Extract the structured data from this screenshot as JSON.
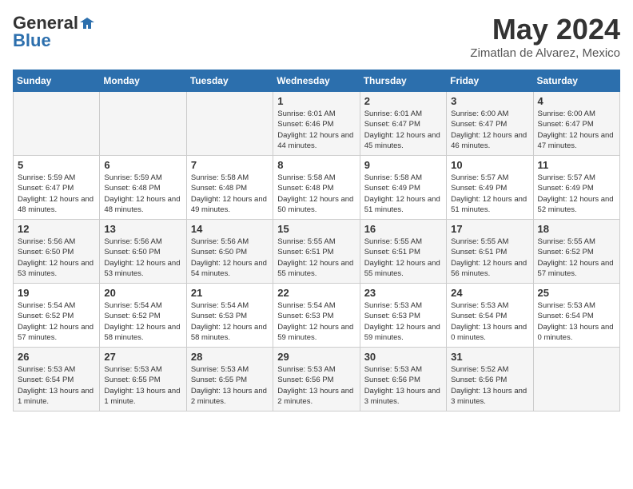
{
  "header": {
    "logo_general": "General",
    "logo_blue": "Blue",
    "month_title": "May 2024",
    "location": "Zimatlan de Alvarez, Mexico"
  },
  "days_of_week": [
    "Sunday",
    "Monday",
    "Tuesday",
    "Wednesday",
    "Thursday",
    "Friday",
    "Saturday"
  ],
  "weeks": [
    {
      "days": [
        {
          "num": "",
          "sunrise": "",
          "sunset": "",
          "daylight": ""
        },
        {
          "num": "",
          "sunrise": "",
          "sunset": "",
          "daylight": ""
        },
        {
          "num": "",
          "sunrise": "",
          "sunset": "",
          "daylight": ""
        },
        {
          "num": "1",
          "sunrise": "Sunrise: 6:01 AM",
          "sunset": "Sunset: 6:46 PM",
          "daylight": "Daylight: 12 hours and 44 minutes."
        },
        {
          "num": "2",
          "sunrise": "Sunrise: 6:01 AM",
          "sunset": "Sunset: 6:47 PM",
          "daylight": "Daylight: 12 hours and 45 minutes."
        },
        {
          "num": "3",
          "sunrise": "Sunrise: 6:00 AM",
          "sunset": "Sunset: 6:47 PM",
          "daylight": "Daylight: 12 hours and 46 minutes."
        },
        {
          "num": "4",
          "sunrise": "Sunrise: 6:00 AM",
          "sunset": "Sunset: 6:47 PM",
          "daylight": "Daylight: 12 hours and 47 minutes."
        }
      ]
    },
    {
      "days": [
        {
          "num": "5",
          "sunrise": "Sunrise: 5:59 AM",
          "sunset": "Sunset: 6:47 PM",
          "daylight": "Daylight: 12 hours and 48 minutes."
        },
        {
          "num": "6",
          "sunrise": "Sunrise: 5:59 AM",
          "sunset": "Sunset: 6:48 PM",
          "daylight": "Daylight: 12 hours and 48 minutes."
        },
        {
          "num": "7",
          "sunrise": "Sunrise: 5:58 AM",
          "sunset": "Sunset: 6:48 PM",
          "daylight": "Daylight: 12 hours and 49 minutes."
        },
        {
          "num": "8",
          "sunrise": "Sunrise: 5:58 AM",
          "sunset": "Sunset: 6:48 PM",
          "daylight": "Daylight: 12 hours and 50 minutes."
        },
        {
          "num": "9",
          "sunrise": "Sunrise: 5:58 AM",
          "sunset": "Sunset: 6:49 PM",
          "daylight": "Daylight: 12 hours and 51 minutes."
        },
        {
          "num": "10",
          "sunrise": "Sunrise: 5:57 AM",
          "sunset": "Sunset: 6:49 PM",
          "daylight": "Daylight: 12 hours and 51 minutes."
        },
        {
          "num": "11",
          "sunrise": "Sunrise: 5:57 AM",
          "sunset": "Sunset: 6:49 PM",
          "daylight": "Daylight: 12 hours and 52 minutes."
        }
      ]
    },
    {
      "days": [
        {
          "num": "12",
          "sunrise": "Sunrise: 5:56 AM",
          "sunset": "Sunset: 6:50 PM",
          "daylight": "Daylight: 12 hours and 53 minutes."
        },
        {
          "num": "13",
          "sunrise": "Sunrise: 5:56 AM",
          "sunset": "Sunset: 6:50 PM",
          "daylight": "Daylight: 12 hours and 53 minutes."
        },
        {
          "num": "14",
          "sunrise": "Sunrise: 5:56 AM",
          "sunset": "Sunset: 6:50 PM",
          "daylight": "Daylight: 12 hours and 54 minutes."
        },
        {
          "num": "15",
          "sunrise": "Sunrise: 5:55 AM",
          "sunset": "Sunset: 6:51 PM",
          "daylight": "Daylight: 12 hours and 55 minutes."
        },
        {
          "num": "16",
          "sunrise": "Sunrise: 5:55 AM",
          "sunset": "Sunset: 6:51 PM",
          "daylight": "Daylight: 12 hours and 55 minutes."
        },
        {
          "num": "17",
          "sunrise": "Sunrise: 5:55 AM",
          "sunset": "Sunset: 6:51 PM",
          "daylight": "Daylight: 12 hours and 56 minutes."
        },
        {
          "num": "18",
          "sunrise": "Sunrise: 5:55 AM",
          "sunset": "Sunset: 6:52 PM",
          "daylight": "Daylight: 12 hours and 57 minutes."
        }
      ]
    },
    {
      "days": [
        {
          "num": "19",
          "sunrise": "Sunrise: 5:54 AM",
          "sunset": "Sunset: 6:52 PM",
          "daylight": "Daylight: 12 hours and 57 minutes."
        },
        {
          "num": "20",
          "sunrise": "Sunrise: 5:54 AM",
          "sunset": "Sunset: 6:52 PM",
          "daylight": "Daylight: 12 hours and 58 minutes."
        },
        {
          "num": "21",
          "sunrise": "Sunrise: 5:54 AM",
          "sunset": "Sunset: 6:53 PM",
          "daylight": "Daylight: 12 hours and 58 minutes."
        },
        {
          "num": "22",
          "sunrise": "Sunrise: 5:54 AM",
          "sunset": "Sunset: 6:53 PM",
          "daylight": "Daylight: 12 hours and 59 minutes."
        },
        {
          "num": "23",
          "sunrise": "Sunrise: 5:53 AM",
          "sunset": "Sunset: 6:53 PM",
          "daylight": "Daylight: 12 hours and 59 minutes."
        },
        {
          "num": "24",
          "sunrise": "Sunrise: 5:53 AM",
          "sunset": "Sunset: 6:54 PM",
          "daylight": "Daylight: 13 hours and 0 minutes."
        },
        {
          "num": "25",
          "sunrise": "Sunrise: 5:53 AM",
          "sunset": "Sunset: 6:54 PM",
          "daylight": "Daylight: 13 hours and 0 minutes."
        }
      ]
    },
    {
      "days": [
        {
          "num": "26",
          "sunrise": "Sunrise: 5:53 AM",
          "sunset": "Sunset: 6:54 PM",
          "daylight": "Daylight: 13 hours and 1 minute."
        },
        {
          "num": "27",
          "sunrise": "Sunrise: 5:53 AM",
          "sunset": "Sunset: 6:55 PM",
          "daylight": "Daylight: 13 hours and 1 minute."
        },
        {
          "num": "28",
          "sunrise": "Sunrise: 5:53 AM",
          "sunset": "Sunset: 6:55 PM",
          "daylight": "Daylight: 13 hours and 2 minutes."
        },
        {
          "num": "29",
          "sunrise": "Sunrise: 5:53 AM",
          "sunset": "Sunset: 6:56 PM",
          "daylight": "Daylight: 13 hours and 2 minutes."
        },
        {
          "num": "30",
          "sunrise": "Sunrise: 5:53 AM",
          "sunset": "Sunset: 6:56 PM",
          "daylight": "Daylight: 13 hours and 3 minutes."
        },
        {
          "num": "31",
          "sunrise": "Sunrise: 5:52 AM",
          "sunset": "Sunset: 6:56 PM",
          "daylight": "Daylight: 13 hours and 3 minutes."
        },
        {
          "num": "",
          "sunrise": "",
          "sunset": "",
          "daylight": ""
        }
      ]
    }
  ]
}
